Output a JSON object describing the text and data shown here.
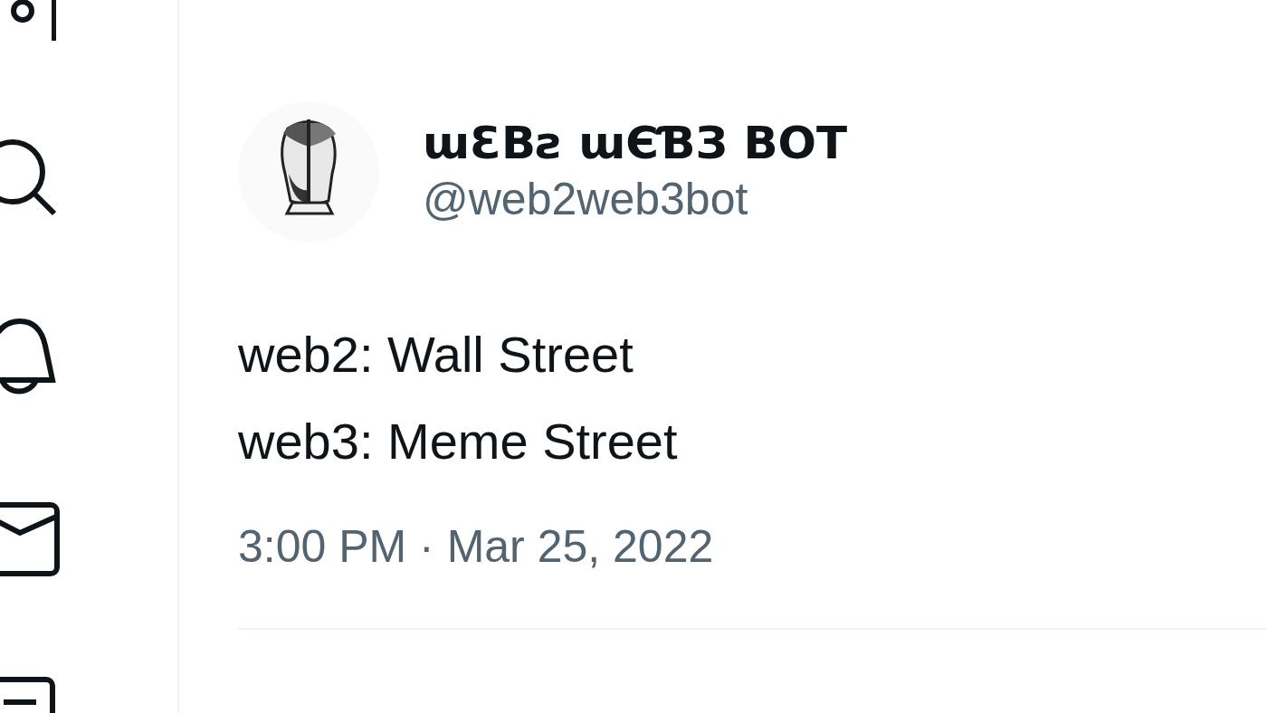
{
  "tweet": {
    "author": {
      "name": "ɯƐBƨ ɯЄƁЗ BOT",
      "handle": "@web2web3bot"
    },
    "text_lines": [
      "web2: Wall Street",
      "web3: Meme Street"
    ],
    "timestamp": "3:00 PM · Mar 25, 2022"
  }
}
